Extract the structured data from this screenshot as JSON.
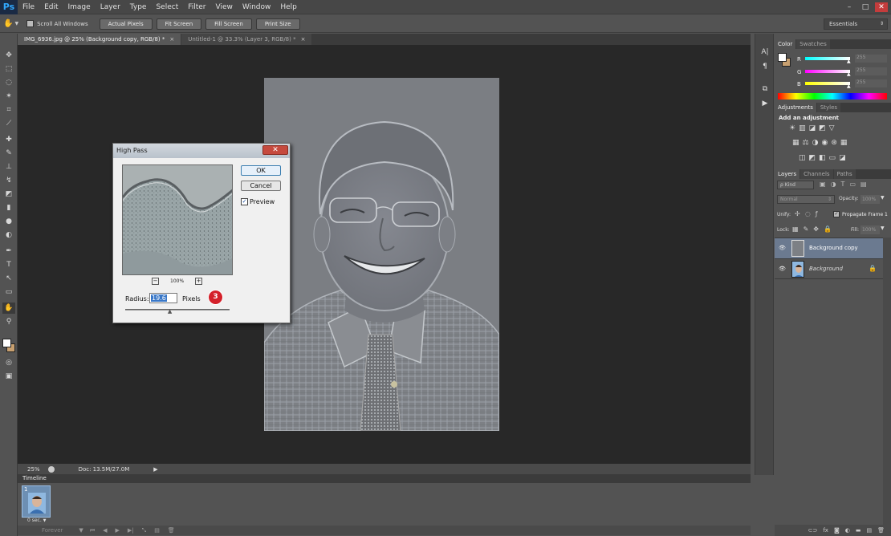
{
  "app": {
    "logo": "Ps",
    "menu": [
      "File",
      "Edit",
      "Image",
      "Layer",
      "Type",
      "Select",
      "Filter",
      "View",
      "Window",
      "Help"
    ],
    "window_controls": [
      "–",
      "□",
      "✕"
    ]
  },
  "options_bar": {
    "scroll_all_windows": "Scroll All Windows",
    "buttons": [
      "Actual Pixels",
      "Fit Screen",
      "Fill Screen",
      "Print Size"
    ],
    "workspace": "Essentials"
  },
  "tabs": [
    {
      "label": "IMG_6936.jpg @ 25% (Background copy, RGB/8) *",
      "close": "×"
    },
    {
      "label": "Untitled-1 @ 33.3% (Layer 3, RGB/8) *",
      "close": "×"
    }
  ],
  "status": {
    "zoom": "25%",
    "doc": "Doc: 13.5M/27.0M"
  },
  "timeline": {
    "title": "Timeline",
    "frame_number": "1",
    "frame_delay": "0 sec.",
    "loop": "Forever"
  },
  "dialog": {
    "title": "High Pass",
    "ok": "OK",
    "cancel": "Cancel",
    "preview_label": "Preview",
    "preview_checked": "✓",
    "zoom_level": "100%",
    "zoom_out": "−",
    "zoom_in": "+",
    "radius_label": "Radius:",
    "radius_value": "19.6",
    "radius_unit": "Pixels",
    "radius_slider_fraction": 0.43,
    "step_badge": "3"
  },
  "color_panel": {
    "tabs": [
      "Color",
      "Swatches"
    ],
    "channels": [
      {
        "label": "R",
        "value": "255",
        "color": "#ff3030"
      },
      {
        "label": "G",
        "value": "255",
        "color": "#e030e0"
      },
      {
        "label": "B",
        "value": "255",
        "color": "#e8e020"
      }
    ]
  },
  "adjustments_panel": {
    "tabs": [
      "Adjustments",
      "Styles"
    ],
    "heading": "Add an adjustment"
  },
  "layers_panel": {
    "tabs": [
      "Layers",
      "Channels",
      "Paths"
    ],
    "kind": "ρ Kind",
    "blend_mode": "Normal",
    "opacity_label": "Opacity:",
    "opacity_value": "100%",
    "unify_label": "Unify:",
    "propagate_label": "Propagate Frame 1",
    "lock_label": "Lock:",
    "fill_label": "Fill:",
    "fill_value": "100%",
    "layers": [
      {
        "name": "Background copy",
        "selected": true,
        "locked": false
      },
      {
        "name": "Background",
        "selected": false,
        "locked": true
      }
    ]
  }
}
